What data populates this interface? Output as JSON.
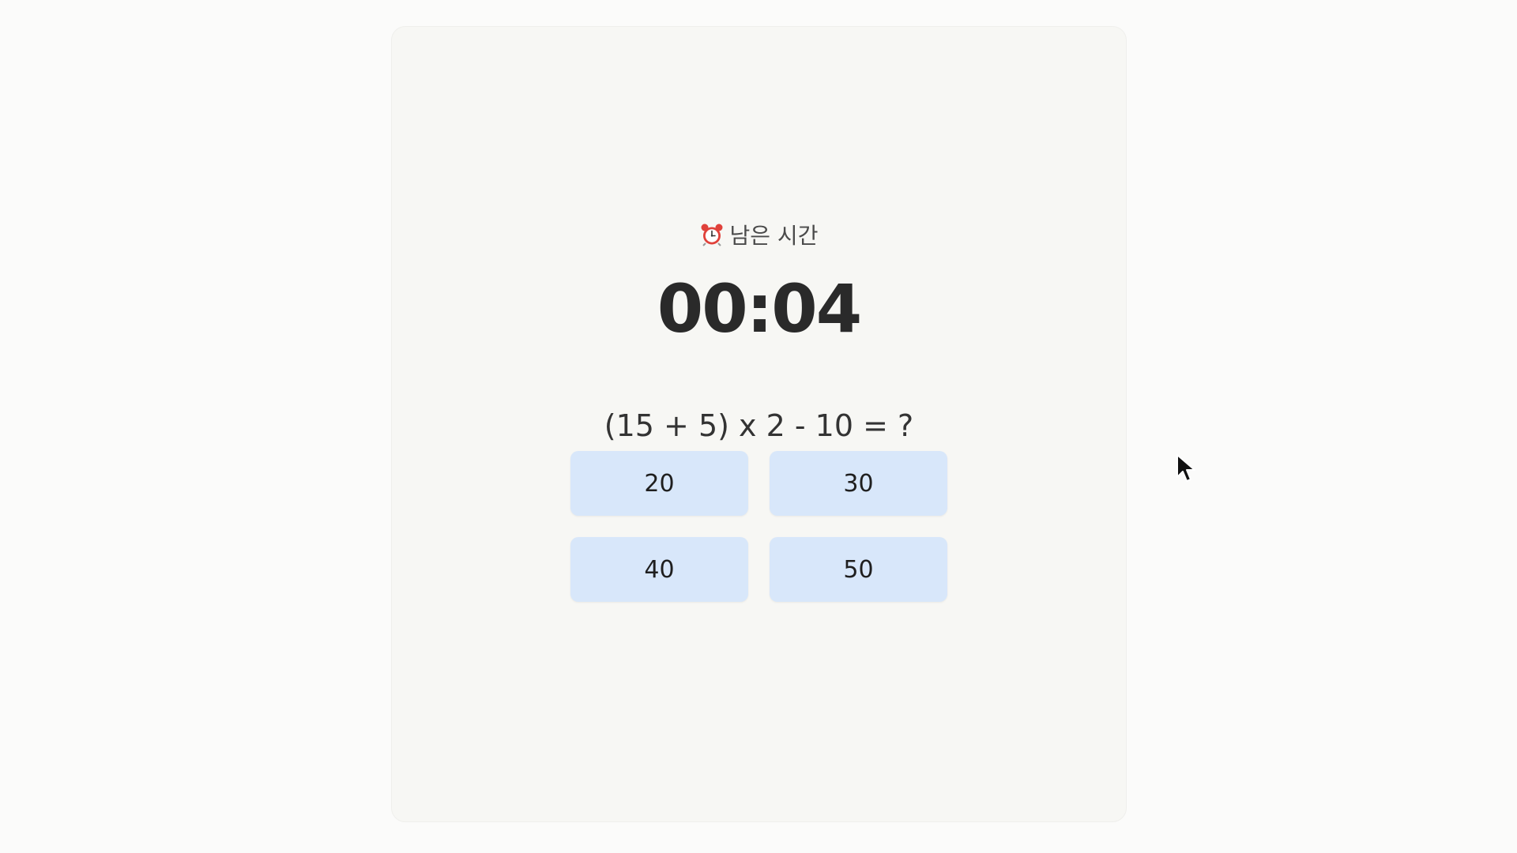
{
  "timer": {
    "icon": "alarm-clock-icon",
    "label": "남은 시간",
    "value": "00:04"
  },
  "question": {
    "text": "(15 + 5) x 2 - 10 = ?"
  },
  "answers": [
    {
      "label": "20"
    },
    {
      "label": "30"
    },
    {
      "label": "40"
    },
    {
      "label": "50"
    }
  ],
  "colors": {
    "page_background": "#fbfbfa",
    "card_background": "#f7f7f4",
    "answer_button": "#d8e7fa",
    "timer_text": "#2a2a2a",
    "alarm_red": "#e0413a"
  },
  "cursor": {
    "icon": "mouse-pointer-icon"
  }
}
